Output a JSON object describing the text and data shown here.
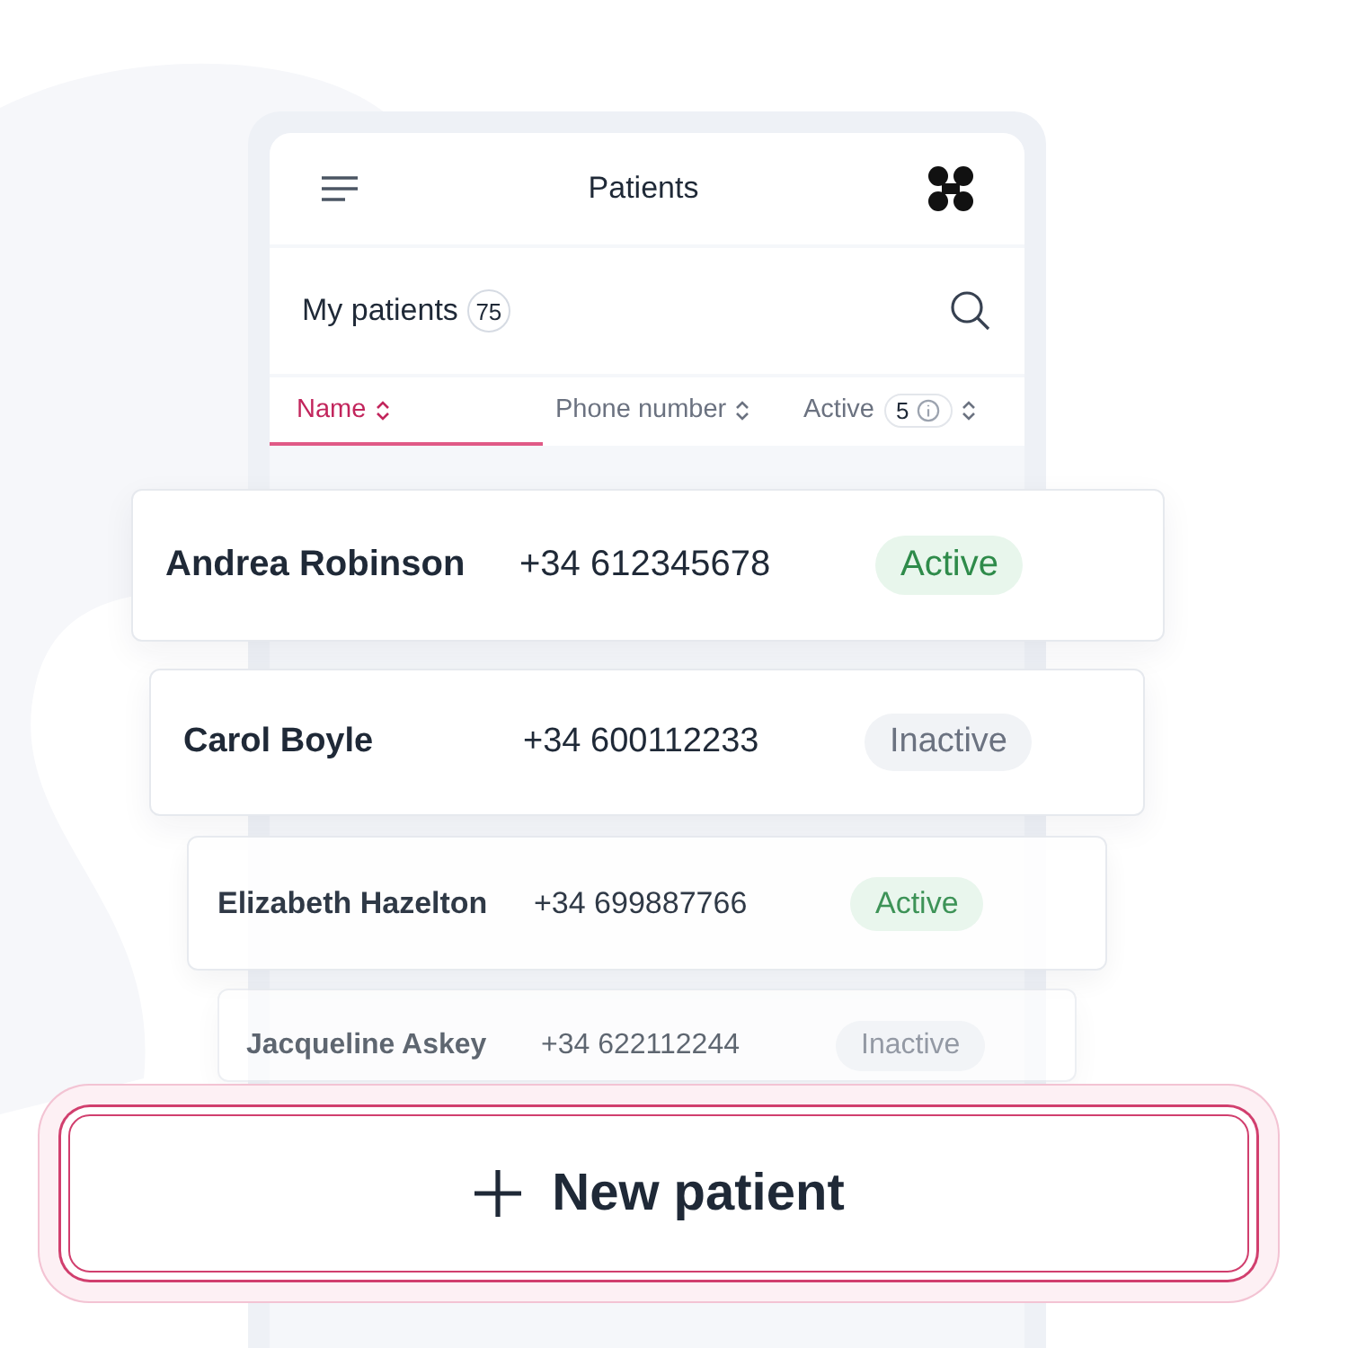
{
  "header": {
    "title": "Patients"
  },
  "section": {
    "title": "My patients",
    "count": "75"
  },
  "columns": [
    {
      "label": "Name",
      "selected": true
    },
    {
      "label": "Phone number",
      "selected": false
    },
    {
      "label": "Active",
      "selected": false,
      "count": "5"
    }
  ],
  "patients": [
    {
      "name": "Andrea Robinson",
      "phone": "+34 612345678",
      "status": "Active",
      "active": true
    },
    {
      "name": "Carol Boyle",
      "phone": "+34 600112233",
      "status": "Inactive",
      "active": false
    },
    {
      "name": "Elizabeth Hazelton",
      "phone": "+34 699887766",
      "status": "Active",
      "active": true
    },
    {
      "name": "Jacqueline Askey",
      "phone": "+34 622112244",
      "status": "Inactive",
      "active": false
    }
  ],
  "button": {
    "label": "New patient"
  }
}
